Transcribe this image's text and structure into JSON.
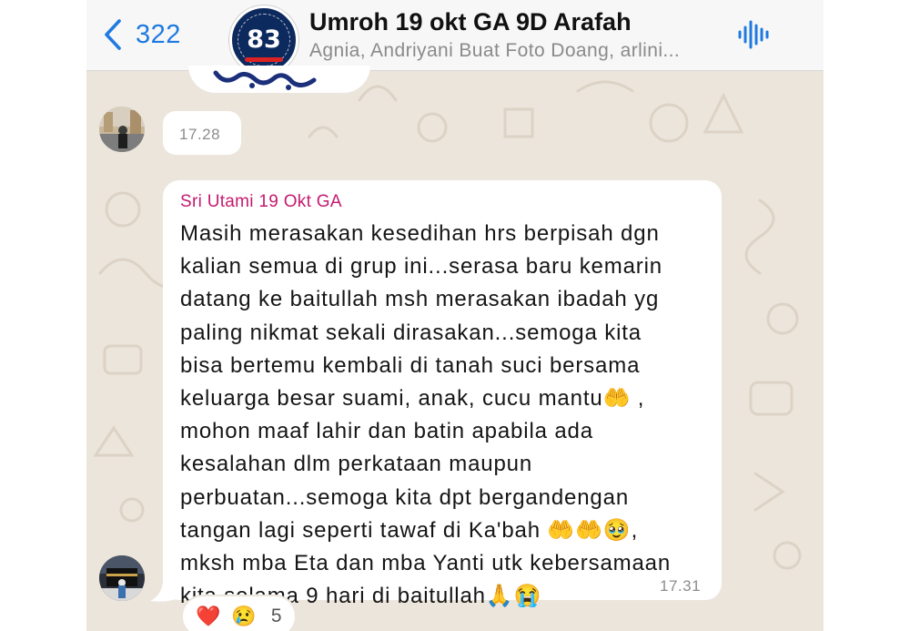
{
  "header": {
    "back_count": "322",
    "title": "Umroh 19 okt GA 9D Arafah",
    "subtitle": "Agnia, Andriyani Buat Foto Doang, arlini...",
    "avatar_number": "83",
    "icons": {
      "back": "chevron-left-icon",
      "voice": "voice-waveform-icon"
    }
  },
  "messages": [
    {
      "type": "image",
      "time": "17.28"
    },
    {
      "type": "text",
      "sender": "Sri Utami 19 Okt GA",
      "text": "Masih merasakan kesedihan hrs berpisah dgn\nkalian semua di grup ini...serasa baru kemarin\ndatang ke baitullah msh merasakan ibadah yg\npaling nikmat  sekali dirasakan...semoga kita\nbisa bertemu kembali di tanah suci bersama\nkeluarga besar suami, anak, cucu mantu🤲 ,\nmohon maaf lahir dan batin  apabila ada\nkesalahan dlm perkataan maupun\nperbuatan...semoga kita dpt bergandengan\ntangan lagi seperti tawaf di Ka'bah 🤲🤲🥹,\nmksh mba Eta dan mba Yanti utk kebersamaan\nkita selama 9 hari di baitullah🙏😭",
      "time": "17.31",
      "reactions": {
        "emojis": [
          "❤️",
          "😢"
        ],
        "count": "5"
      }
    }
  ],
  "colors": {
    "accent": "#1F7AE0",
    "sender": "#C51A6F",
    "chat_background": "#ECE5DB",
    "bubble": "#FFFFFF"
  }
}
